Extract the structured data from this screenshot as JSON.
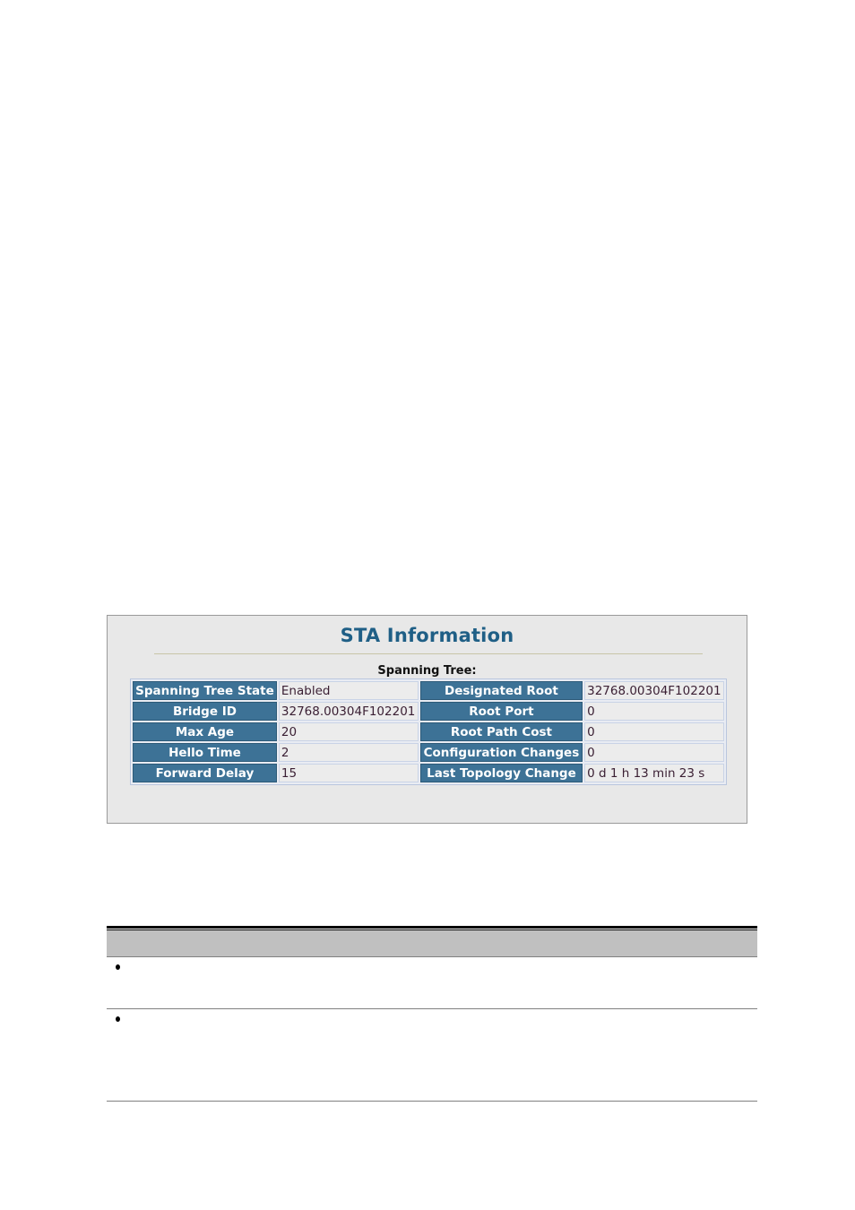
{
  "panel": {
    "title": "STA Information",
    "subtitle": "Spanning Tree:",
    "rows": [
      {
        "label_left": "Spanning Tree State",
        "value_left": "Enabled",
        "label_right": "Designated Root",
        "value_right": "32768.00304F102201"
      },
      {
        "label_left": "Bridge ID",
        "value_left": "32768.00304F102201",
        "label_right": "Root Port",
        "value_right": "0"
      },
      {
        "label_left": "Max Age",
        "value_left": "20",
        "label_right": "Root Path Cost",
        "value_right": "0"
      },
      {
        "label_left": "Hello Time",
        "value_left": "2",
        "label_right": "Configuration Changes",
        "value_right": "0"
      },
      {
        "label_left": "Forward Delay",
        "value_left": "15",
        "label_right": "Last Topology Change",
        "value_right": "0 d 1 h 13 min 23 s"
      }
    ]
  },
  "description_table": {
    "bullets": [
      "bullet-icon",
      "bullet-icon"
    ]
  }
}
